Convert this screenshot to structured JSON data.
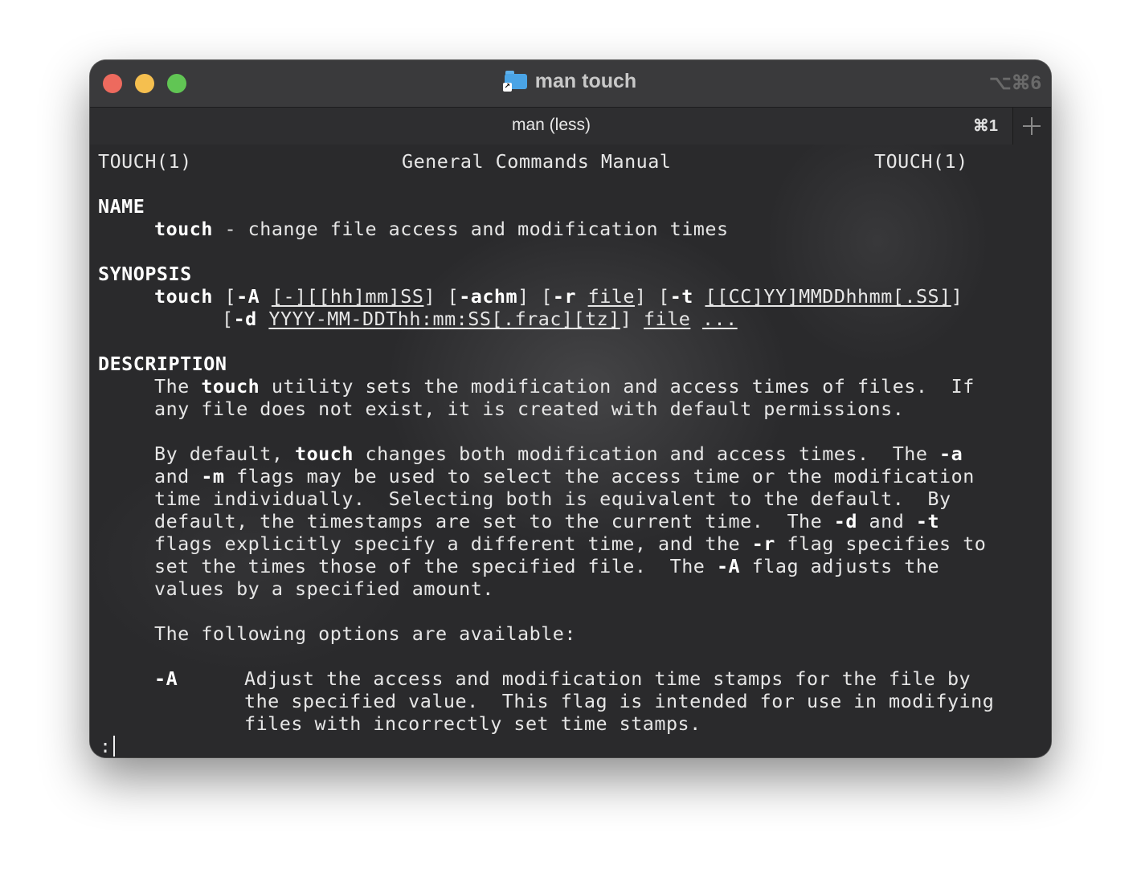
{
  "window": {
    "title": "man touch",
    "shortcut": "⌥⌘6"
  },
  "tab": {
    "label": "man (less)",
    "shortcut": "⌘1"
  },
  "man": {
    "header_left": "TOUCH(1)",
    "header_center": "General Commands Manual",
    "header_right": "TOUCH(1)",
    "name_heading": "NAME",
    "name_cmd": "touch",
    "name_desc": " - change file access and modification times",
    "synopsis_heading": "SYNOPSIS",
    "synopsis": {
      "cmd": "touch",
      "open_A": " [",
      "flag_A": "-A",
      "sp1": " ",
      "arg_A": "[-][[hh]mm]SS",
      "close_A": "] [",
      "flag_achm": "-achm",
      "close_achm": "] [",
      "flag_r": "-r",
      "sp2": " ",
      "arg_r": "file",
      "close_r": "] [",
      "flag_t": "-t",
      "sp3": " ",
      "arg_t": "[[CC]YY]MMDDhhmm[.SS]",
      "close_t": "]",
      "open_d": "[",
      "flag_d": "-d",
      "sp4": " ",
      "arg_d": "YYYY-MM-DDThh:mm:SS[.frac][tz]",
      "close_d": "] ",
      "file": "file",
      "sp5": " ",
      "ellipsis": "..."
    },
    "description_heading": "DESCRIPTION",
    "desc1_a": "The ",
    "desc1_b": "touch",
    "desc1_c": " utility sets the modification and access times of files.  If",
    "desc2": "any file does not exist, it is created with default permissions.",
    "p2_l1_a": "By default, ",
    "p2_l1_b": "touch",
    "p2_l1_c": " changes both modification and access times.  The ",
    "p2_l1_d": "-a",
    "p2_l2_a": "and ",
    "p2_l2_b": "-m",
    "p2_l2_c": " flags may be used to select the access time or the modification",
    "p2_l3": "time individually.  Selecting both is equivalent to the default.  By",
    "p2_l4_a": "default, the timestamps are set to the current time.  The ",
    "p2_l4_b": "-d",
    "p2_l4_c": " and ",
    "p2_l4_d": "-t",
    "p2_l5_a": "flags explicitly specify a different time, and the ",
    "p2_l5_b": "-r",
    "p2_l5_c": " flag specifies to",
    "p2_l6_a": "set the times those of the specified file.  The ",
    "p2_l6_b": "-A",
    "p2_l6_c": " flag adjusts the",
    "p2_l7": "values by a specified amount.",
    "options_intro": "The following options are available:",
    "opt_A_flag": "-A",
    "opt_A_l1": "Adjust the access and modification time stamps for the file by",
    "opt_A_l2": "the specified value.  This flag is intended for use in modifying",
    "opt_A_l3": "files with incorrectly set time stamps."
  },
  "prompt": ":"
}
